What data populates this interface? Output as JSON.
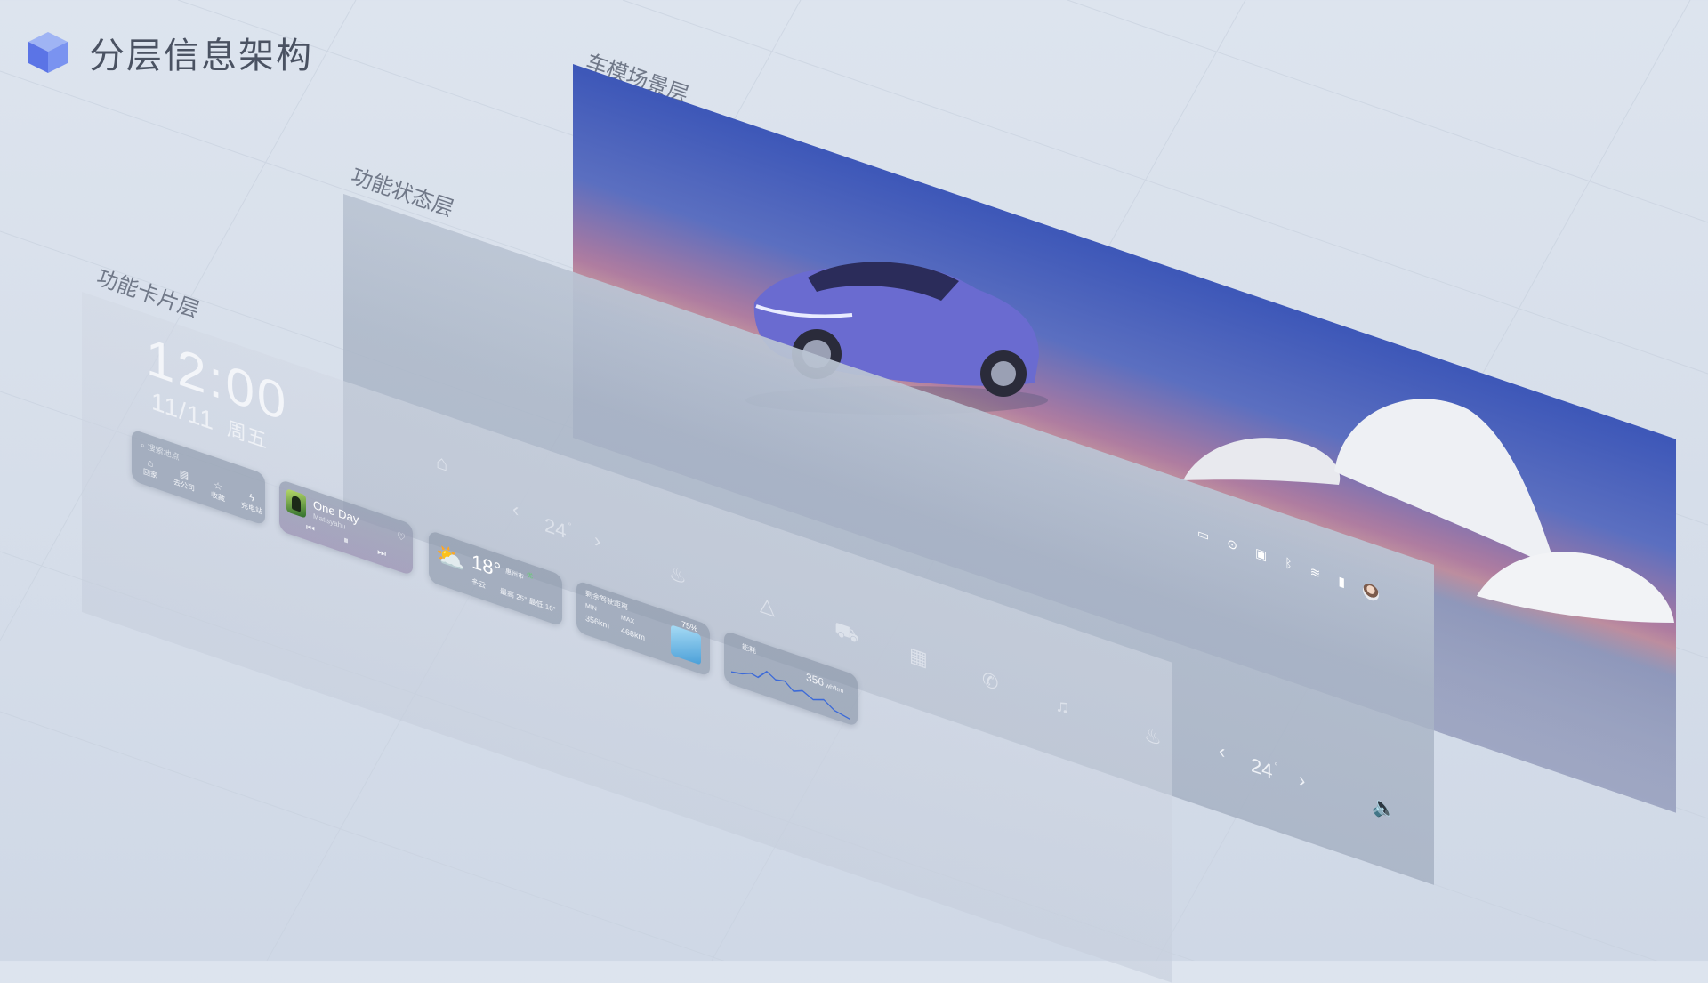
{
  "header": {
    "title": "分层信息架构"
  },
  "layers": {
    "scene": "车模场景层",
    "status": "功能状态层",
    "cards": "功能卡片层"
  },
  "clock": {
    "time": "12:00",
    "date": "11/11",
    "weekday": "周五"
  },
  "search_card": {
    "placeholder": "搜索地点",
    "links": [
      "回家",
      "去公司",
      "收藏",
      "充电站"
    ]
  },
  "music_card": {
    "title": "One Day",
    "artist": "Matisyahu"
  },
  "weather_card": {
    "temp": "18°",
    "city": "惠州市",
    "aqi": "优",
    "desc": "多云",
    "range": "最高 25° 最低 16°"
  },
  "range_card": {
    "title": "剩余驾驶距离",
    "min_label": "MIN",
    "min_value": "356km",
    "max_label": "MAX",
    "max_value": "468km",
    "battery": "75%"
  },
  "energy_card": {
    "label": "能耗",
    "value": "356",
    "unit": "wh/km"
  },
  "climate": {
    "left_temp": "24",
    "right_temp": "24",
    "degree": "°"
  },
  "colors": {
    "background": "#d5dde9",
    "sky_top": "#3d57b8",
    "car_body": "#6a6bd0",
    "card_bg": "#808ca0"
  },
  "icons": {
    "dock": [
      "home-icon",
      "seat-heat-icon",
      "navigation-icon",
      "car-icon",
      "apps-grid-icon",
      "phone-icon",
      "music-icon",
      "seat-right-icon",
      "volume-icon"
    ],
    "status": [
      "dashcam-icon",
      "location-icon",
      "message-icon",
      "bluetooth-icon",
      "wifi-icon",
      "signal-icon",
      "avatar"
    ]
  }
}
